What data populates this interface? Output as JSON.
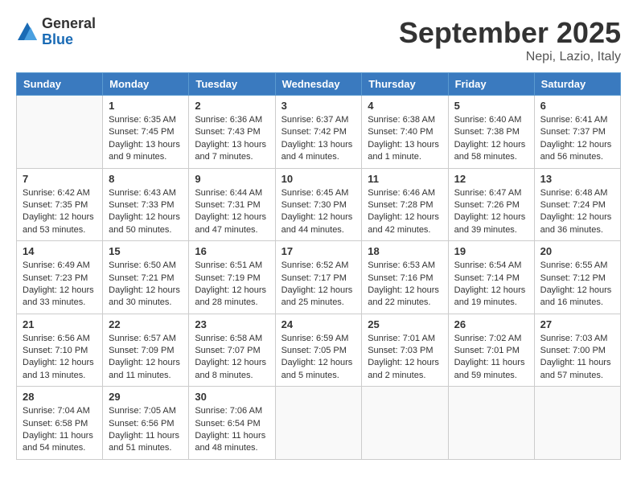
{
  "logo": {
    "general": "General",
    "blue": "Blue"
  },
  "header": {
    "month": "September 2025",
    "location": "Nepi, Lazio, Italy"
  },
  "weekdays": [
    "Sunday",
    "Monday",
    "Tuesday",
    "Wednesday",
    "Thursday",
    "Friday",
    "Saturday"
  ],
  "weeks": [
    [
      {
        "day": "",
        "sunrise": "",
        "sunset": "",
        "daylight": ""
      },
      {
        "day": "1",
        "sunrise": "Sunrise: 6:35 AM",
        "sunset": "Sunset: 7:45 PM",
        "daylight": "Daylight: 13 hours and 9 minutes."
      },
      {
        "day": "2",
        "sunrise": "Sunrise: 6:36 AM",
        "sunset": "Sunset: 7:43 PM",
        "daylight": "Daylight: 13 hours and 7 minutes."
      },
      {
        "day": "3",
        "sunrise": "Sunrise: 6:37 AM",
        "sunset": "Sunset: 7:42 PM",
        "daylight": "Daylight: 13 hours and 4 minutes."
      },
      {
        "day": "4",
        "sunrise": "Sunrise: 6:38 AM",
        "sunset": "Sunset: 7:40 PM",
        "daylight": "Daylight: 13 hours and 1 minute."
      },
      {
        "day": "5",
        "sunrise": "Sunrise: 6:40 AM",
        "sunset": "Sunset: 7:38 PM",
        "daylight": "Daylight: 12 hours and 58 minutes."
      },
      {
        "day": "6",
        "sunrise": "Sunrise: 6:41 AM",
        "sunset": "Sunset: 7:37 PM",
        "daylight": "Daylight: 12 hours and 56 minutes."
      }
    ],
    [
      {
        "day": "7",
        "sunrise": "Sunrise: 6:42 AM",
        "sunset": "Sunset: 7:35 PM",
        "daylight": "Daylight: 12 hours and 53 minutes."
      },
      {
        "day": "8",
        "sunrise": "Sunrise: 6:43 AM",
        "sunset": "Sunset: 7:33 PM",
        "daylight": "Daylight: 12 hours and 50 minutes."
      },
      {
        "day": "9",
        "sunrise": "Sunrise: 6:44 AM",
        "sunset": "Sunset: 7:31 PM",
        "daylight": "Daylight: 12 hours and 47 minutes."
      },
      {
        "day": "10",
        "sunrise": "Sunrise: 6:45 AM",
        "sunset": "Sunset: 7:30 PM",
        "daylight": "Daylight: 12 hours and 44 minutes."
      },
      {
        "day": "11",
        "sunrise": "Sunrise: 6:46 AM",
        "sunset": "Sunset: 7:28 PM",
        "daylight": "Daylight: 12 hours and 42 minutes."
      },
      {
        "day": "12",
        "sunrise": "Sunrise: 6:47 AM",
        "sunset": "Sunset: 7:26 PM",
        "daylight": "Daylight: 12 hours and 39 minutes."
      },
      {
        "day": "13",
        "sunrise": "Sunrise: 6:48 AM",
        "sunset": "Sunset: 7:24 PM",
        "daylight": "Daylight: 12 hours and 36 minutes."
      }
    ],
    [
      {
        "day": "14",
        "sunrise": "Sunrise: 6:49 AM",
        "sunset": "Sunset: 7:23 PM",
        "daylight": "Daylight: 12 hours and 33 minutes."
      },
      {
        "day": "15",
        "sunrise": "Sunrise: 6:50 AM",
        "sunset": "Sunset: 7:21 PM",
        "daylight": "Daylight: 12 hours and 30 minutes."
      },
      {
        "day": "16",
        "sunrise": "Sunrise: 6:51 AM",
        "sunset": "Sunset: 7:19 PM",
        "daylight": "Daylight: 12 hours and 28 minutes."
      },
      {
        "day": "17",
        "sunrise": "Sunrise: 6:52 AM",
        "sunset": "Sunset: 7:17 PM",
        "daylight": "Daylight: 12 hours and 25 minutes."
      },
      {
        "day": "18",
        "sunrise": "Sunrise: 6:53 AM",
        "sunset": "Sunset: 7:16 PM",
        "daylight": "Daylight: 12 hours and 22 minutes."
      },
      {
        "day": "19",
        "sunrise": "Sunrise: 6:54 AM",
        "sunset": "Sunset: 7:14 PM",
        "daylight": "Daylight: 12 hours and 19 minutes."
      },
      {
        "day": "20",
        "sunrise": "Sunrise: 6:55 AM",
        "sunset": "Sunset: 7:12 PM",
        "daylight": "Daylight: 12 hours and 16 minutes."
      }
    ],
    [
      {
        "day": "21",
        "sunrise": "Sunrise: 6:56 AM",
        "sunset": "Sunset: 7:10 PM",
        "daylight": "Daylight: 12 hours and 13 minutes."
      },
      {
        "day": "22",
        "sunrise": "Sunrise: 6:57 AM",
        "sunset": "Sunset: 7:09 PM",
        "daylight": "Daylight: 12 hours and 11 minutes."
      },
      {
        "day": "23",
        "sunrise": "Sunrise: 6:58 AM",
        "sunset": "Sunset: 7:07 PM",
        "daylight": "Daylight: 12 hours and 8 minutes."
      },
      {
        "day": "24",
        "sunrise": "Sunrise: 6:59 AM",
        "sunset": "Sunset: 7:05 PM",
        "daylight": "Daylight: 12 hours and 5 minutes."
      },
      {
        "day": "25",
        "sunrise": "Sunrise: 7:01 AM",
        "sunset": "Sunset: 7:03 PM",
        "daylight": "Daylight: 12 hours and 2 minutes."
      },
      {
        "day": "26",
        "sunrise": "Sunrise: 7:02 AM",
        "sunset": "Sunset: 7:01 PM",
        "daylight": "Daylight: 11 hours and 59 minutes."
      },
      {
        "day": "27",
        "sunrise": "Sunrise: 7:03 AM",
        "sunset": "Sunset: 7:00 PM",
        "daylight": "Daylight: 11 hours and 57 minutes."
      }
    ],
    [
      {
        "day": "28",
        "sunrise": "Sunrise: 7:04 AM",
        "sunset": "Sunset: 6:58 PM",
        "daylight": "Daylight: 11 hours and 54 minutes."
      },
      {
        "day": "29",
        "sunrise": "Sunrise: 7:05 AM",
        "sunset": "Sunset: 6:56 PM",
        "daylight": "Daylight: 11 hours and 51 minutes."
      },
      {
        "day": "30",
        "sunrise": "Sunrise: 7:06 AM",
        "sunset": "Sunset: 6:54 PM",
        "daylight": "Daylight: 11 hours and 48 minutes."
      },
      {
        "day": "",
        "sunrise": "",
        "sunset": "",
        "daylight": ""
      },
      {
        "day": "",
        "sunrise": "",
        "sunset": "",
        "daylight": ""
      },
      {
        "day": "",
        "sunrise": "",
        "sunset": "",
        "daylight": ""
      },
      {
        "day": "",
        "sunrise": "",
        "sunset": "",
        "daylight": ""
      }
    ]
  ]
}
